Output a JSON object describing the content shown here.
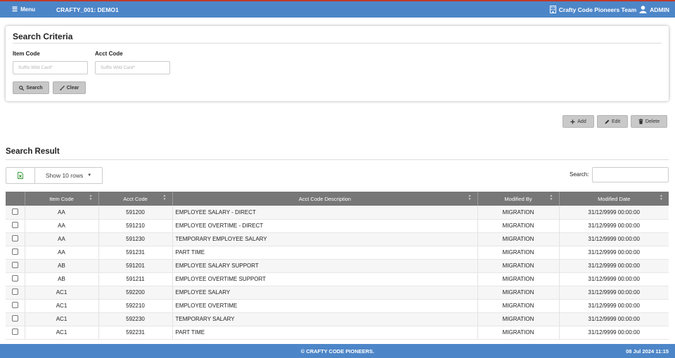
{
  "topbar": {
    "menu_label": "Menu",
    "app_title": "CRAFTY_001: DEMO1",
    "team_name": "Crafty Code Pioneers Team",
    "user_name": "ADMIN"
  },
  "search_criteria": {
    "title": "Search Criteria",
    "item_code_label": "Item Code",
    "item_code_placeholder": "Suffix Wild Card*",
    "item_code_value": "",
    "acct_code_label": "Acct Code",
    "acct_code_placeholder": "Suffix Wild Card*",
    "acct_code_value": "",
    "search_label": "Search",
    "clear_label": "Clear"
  },
  "actions": {
    "add_label": "Add",
    "edit_label": "Edit",
    "delete_label": "Delete"
  },
  "result": {
    "title": "Search Result",
    "show_rows_label": "Show 10 rows",
    "search_label": "Search:",
    "search_value": "",
    "columns": [
      "Item Code",
      "Acct Code",
      "Acct Code Description",
      "Modified By",
      "Modified Date"
    ],
    "rows": [
      {
        "item_code": "AA",
        "acct_code": "591200",
        "desc": "EMPLOYEE SALARY - DIRECT",
        "modified_by": "MIGRATION",
        "modified_date": "31/12/9999 00:00:00"
      },
      {
        "item_code": "AA",
        "acct_code": "591210",
        "desc": "EMPLOYEE OVERTIME - DIRECT",
        "modified_by": "MIGRATION",
        "modified_date": "31/12/9999 00:00:00"
      },
      {
        "item_code": "AA",
        "acct_code": "591230",
        "desc": "TEMPORARY EMPLOYEE SALARY",
        "modified_by": "MIGRATION",
        "modified_date": "31/12/9999 00:00:00"
      },
      {
        "item_code": "AA",
        "acct_code": "591231",
        "desc": "PART TIME",
        "modified_by": "MIGRATION",
        "modified_date": "31/12/9999 00:00:00"
      },
      {
        "item_code": "AB",
        "acct_code": "591201",
        "desc": "EMPLOYEE SALARY SUPPORT",
        "modified_by": "MIGRATION",
        "modified_date": "31/12/9999 00:00:00"
      },
      {
        "item_code": "AB",
        "acct_code": "591211",
        "desc": "EMPLOYEE OVERTIME SUPPORT",
        "modified_by": "MIGRATION",
        "modified_date": "31/12/9999 00:00:00"
      },
      {
        "item_code": "AC1",
        "acct_code": "592200",
        "desc": "EMPLOYEE SALARY",
        "modified_by": "MIGRATION",
        "modified_date": "31/12/9999 00:00:00"
      },
      {
        "item_code": "AC1",
        "acct_code": "592210",
        "desc": "EMPLOYEE OVERTIME",
        "modified_by": "MIGRATION",
        "modified_date": "31/12/9999 00:00:00"
      },
      {
        "item_code": "AC1",
        "acct_code": "592230",
        "desc": "TEMPORARY SALARY",
        "modified_by": "MIGRATION",
        "modified_date": "31/12/9999 00:00:00"
      },
      {
        "item_code": "AC1",
        "acct_code": "592231",
        "desc": "PART TIME",
        "modified_by": "MIGRATION",
        "modified_date": "31/12/9999 00:00:00"
      }
    ]
  },
  "footer": {
    "copyright": "© CRAFTY CODE PIONEERS.",
    "datetime": "08 Jul 2024 11:15"
  },
  "colors": {
    "header_blue": "#4d86c8",
    "table_header": "#777777",
    "button_grey": "#c8c8c8"
  }
}
